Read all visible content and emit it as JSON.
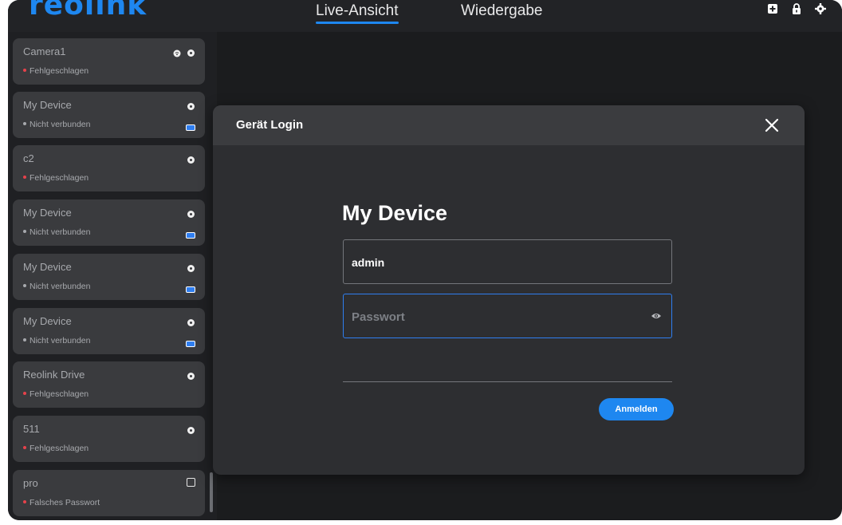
{
  "app": {
    "logo": "reolink"
  },
  "nav": {
    "tabs": [
      {
        "label": "Live-Ansicht",
        "active": true
      },
      {
        "label": "Wiedergabe",
        "active": false
      }
    ]
  },
  "topbar_icons": [
    "add-icon",
    "lock-icon",
    "gear-icon"
  ],
  "sidebar": {
    "devices": [
      {
        "name": "Camera1",
        "status": "Fehlgeschlagen",
        "status_color": "#e6424b",
        "icons": [
          "wifi-icon",
          "info-icon"
        ]
      },
      {
        "name": "My Device",
        "status": "Nicht verbunden",
        "status_color": "#a7a9ad",
        "icons": [
          "info-icon",
          "battery-icon"
        ]
      },
      {
        "name": "c2",
        "status": "Fehlgeschlagen",
        "status_color": "#e6424b",
        "icons": [
          "info-icon"
        ]
      },
      {
        "name": "My Device",
        "status": "Nicht verbunden",
        "status_color": "#a7a9ad",
        "icons": [
          "info-icon",
          "battery-icon"
        ]
      },
      {
        "name": "My Device",
        "status": "Nicht verbunden",
        "status_color": "#a7a9ad",
        "icons": [
          "info-icon",
          "battery-icon"
        ]
      },
      {
        "name": "My Device",
        "status": "Nicht verbunden",
        "status_color": "#a7a9ad",
        "icons": [
          "info-icon",
          "battery-icon"
        ]
      },
      {
        "name": "Reolink Drive",
        "status": "Fehlgeschlagen",
        "status_color": "#e6424b",
        "icons": [
          "info-icon"
        ]
      },
      {
        "name": "511",
        "status": "Fehlgeschlagen",
        "status_color": "#e6424b",
        "icons": [
          "info-icon"
        ]
      },
      {
        "name": "pro",
        "status": "Falsches Passwort",
        "status_color": "#e6424b",
        "icons": [
          "edit-icon"
        ]
      }
    ]
  },
  "modal": {
    "title": "Gerät Login",
    "device_name": "My Device",
    "username_value": "admin",
    "password_placeholder": "Passwort",
    "submit_label": "Anmelden"
  },
  "colors": {
    "accent": "#1e87f0",
    "error": "#e6424b",
    "bg": "#1b1c1e",
    "card": "#3a3b3e"
  }
}
